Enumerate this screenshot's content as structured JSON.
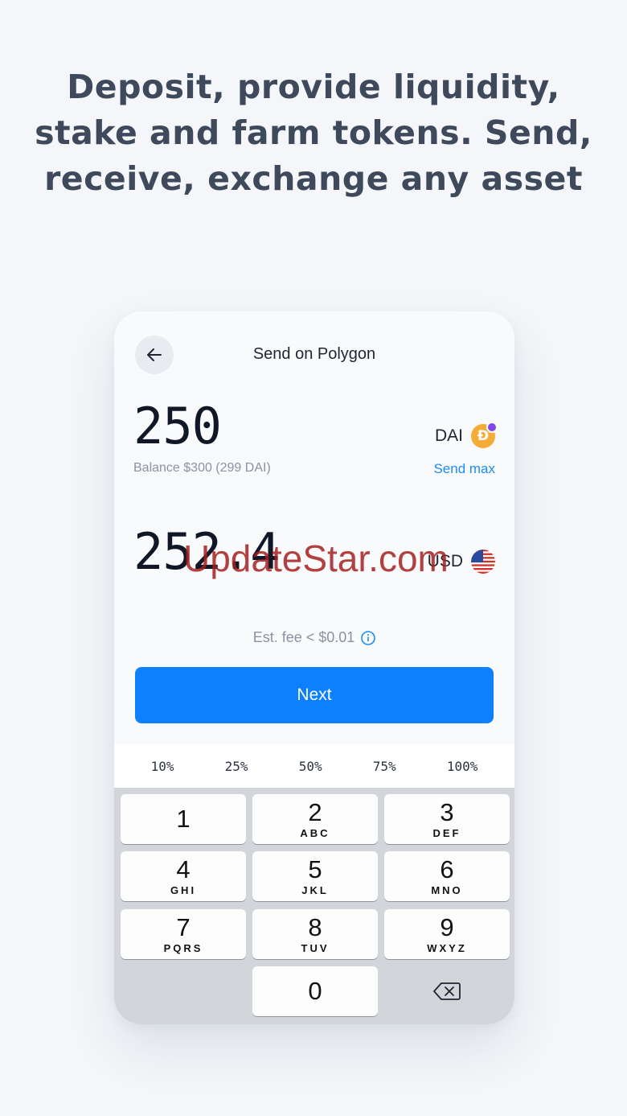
{
  "headline": {
    "lines": [
      "Deposit, provide liquidity,",
      "stake and farm tokens. Send,",
      "receive, exchange any asset"
    ]
  },
  "header": {
    "title": "Send on Polygon",
    "back_icon": "arrow-left-icon"
  },
  "send": {
    "amount": "250",
    "currency": "DAI",
    "currency_icon": "dai-coin-icon",
    "balance": "Balance $300 (299 DAI)",
    "send_max_label": "Send max"
  },
  "convert": {
    "amount": "252.4",
    "currency": "USD",
    "currency_icon": "us-flag-icon"
  },
  "watermark": "UpdateStar.com",
  "fee": {
    "label": "Est. fee < $0.01",
    "icon": "info-icon"
  },
  "next_label": "Next",
  "percentages": [
    "10%",
    "25%",
    "50%",
    "75%",
    "100%"
  ],
  "keypad": [
    {
      "num": "1",
      "letters": ""
    },
    {
      "num": "2",
      "letters": "ABC"
    },
    {
      "num": "3",
      "letters": "DEF"
    },
    {
      "num": "4",
      "letters": "GHI"
    },
    {
      "num": "5",
      "letters": "JKL"
    },
    {
      "num": "6",
      "letters": "MNO"
    },
    {
      "num": "7",
      "letters": "PQRS"
    },
    {
      "num": "8",
      "letters": "TUV"
    },
    {
      "num": "9",
      "letters": "WXYZ"
    },
    {
      "num": "0",
      "letters": ""
    }
  ],
  "delete_icon": "backspace-icon",
  "colors": {
    "accent": "#0d80ff",
    "link": "#1c8cf0",
    "dai": "#f5ac37",
    "polygon": "#8247e5"
  }
}
